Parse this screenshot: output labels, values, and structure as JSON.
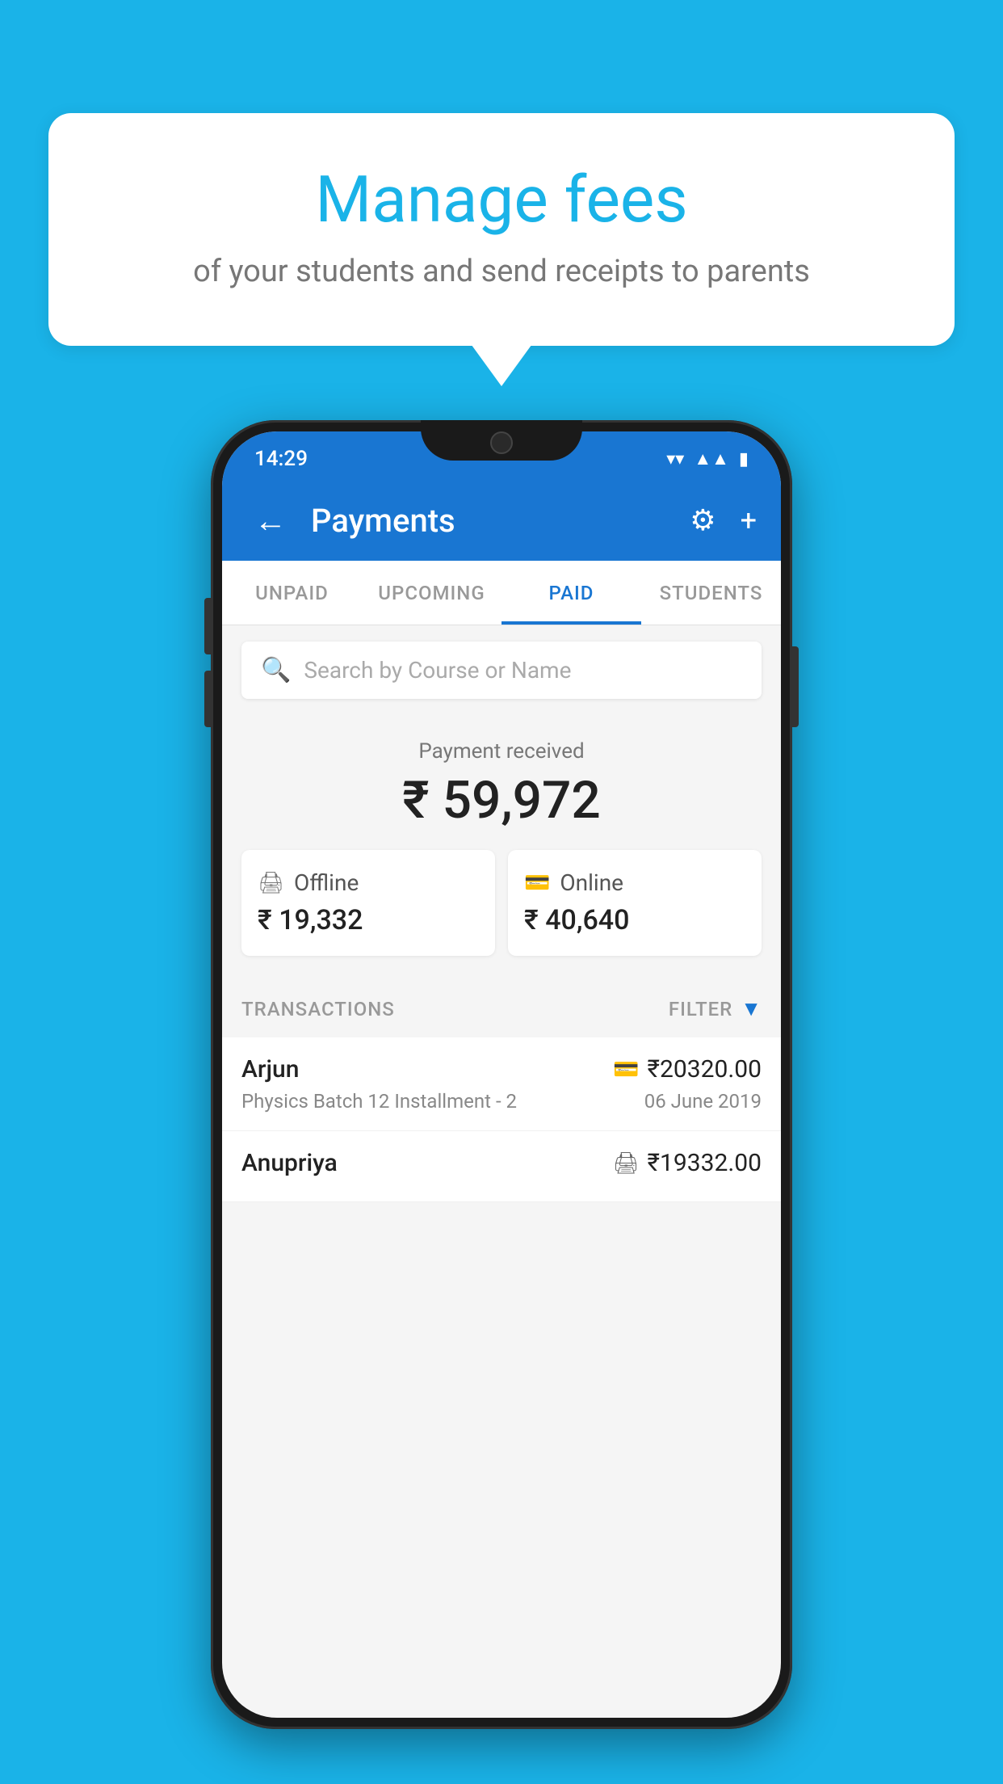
{
  "background_color": "#1ab3e8",
  "bubble": {
    "title": "Manage fees",
    "subtitle": "of your students and send receipts to parents"
  },
  "status_bar": {
    "time": "14:29",
    "wifi": "▼",
    "signal": "◀",
    "battery": "▮"
  },
  "app_bar": {
    "title": "Payments",
    "back_label": "←",
    "gear_label": "⚙",
    "plus_label": "+"
  },
  "tabs": [
    {
      "label": "UNPAID",
      "active": false
    },
    {
      "label": "UPCOMING",
      "active": false
    },
    {
      "label": "PAID",
      "active": true
    },
    {
      "label": "STUDENTS",
      "active": false
    }
  ],
  "search": {
    "placeholder": "Search by Course or Name"
  },
  "payment_summary": {
    "label": "Payment received",
    "amount": "₹ 59,972",
    "offline": {
      "type": "Offline",
      "amount": "₹ 19,332"
    },
    "online": {
      "type": "Online",
      "amount": "₹ 40,640"
    }
  },
  "transactions_section": {
    "label": "TRANSACTIONS",
    "filter_label": "FILTER"
  },
  "transactions": [
    {
      "name": "Arjun",
      "course": "Physics Batch 12 Installment - 2",
      "amount": "₹20320.00",
      "date": "06 June 2019",
      "payment_type": "card"
    },
    {
      "name": "Anupriya",
      "course": "",
      "amount": "₹19332.00",
      "date": "",
      "payment_type": "offline"
    }
  ]
}
